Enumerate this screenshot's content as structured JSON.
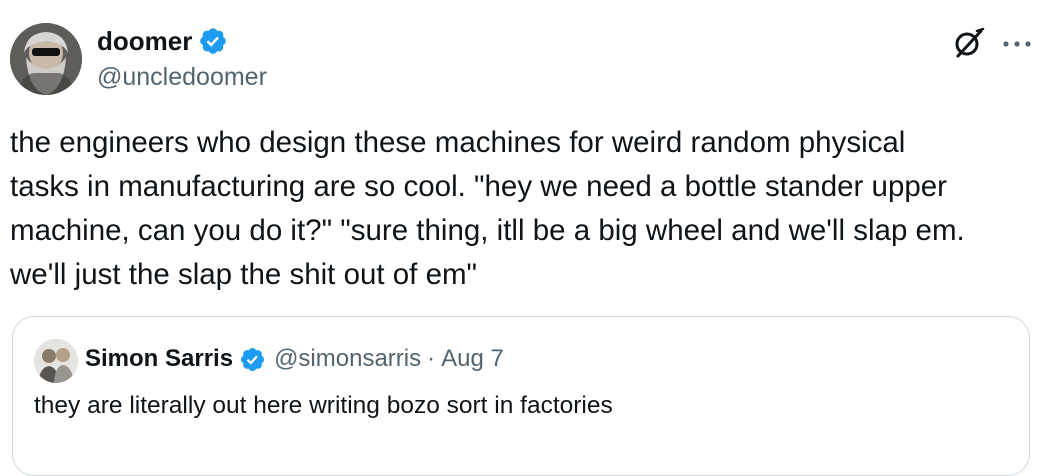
{
  "author": {
    "name": "doomer",
    "handle": "@uncledoomer"
  },
  "tweet": {
    "text": "the engineers who design these machines for weird random physical\ntasks in manufacturing are so cool. \"hey we need a bottle stander upper\nmachine, can you do it?\" \"sure thing, itll be a big wheel and we'll slap em.\nwe'll just the slap the shit out of em\""
  },
  "quoted": {
    "name": "Simon Sarris",
    "handle": "@simonsarris",
    "separator": "·",
    "date": "Aug 7",
    "text": "they are literally out here writing bozo sort in factories"
  },
  "icons": {
    "verified": "verified-badge-icon",
    "grok": "grok-icon",
    "more": "more-options-icon"
  },
  "colors": {
    "verified": "#1d9bf0",
    "text": "#0f1419",
    "secondary": "#536471",
    "border": "#cfd9de"
  }
}
